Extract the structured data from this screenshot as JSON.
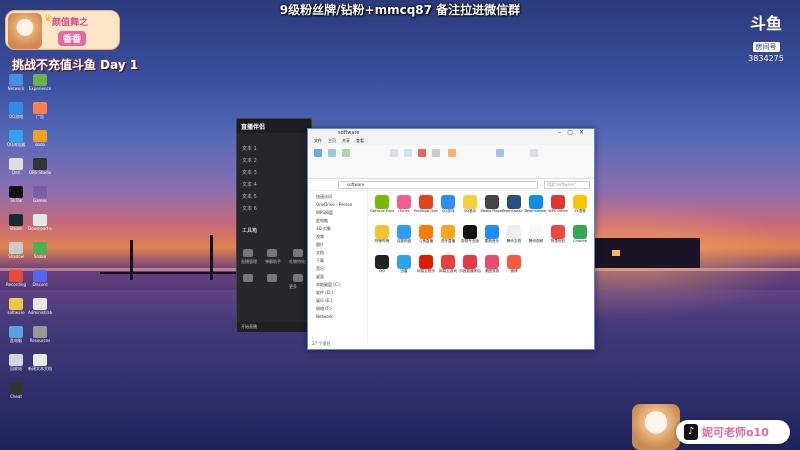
{
  "overlay": {
    "top_banner": "9级粉丝牌/钻粉+mmcq87 备注拉进微信群",
    "badge_title": "颜值舞之",
    "badge_name": "香香",
    "challenge_text": "挑战不充值斗鱼 Day 1",
    "platform_logo": "斗鱼",
    "room_label": "房间号",
    "room_id": "3834275",
    "streamer_handle": "妮可老师o10"
  },
  "desktop_icons": [
    {
      "label": "Network",
      "color": "#4a90e2"
    },
    {
      "label": "Experience",
      "color": "#6ab04c"
    },
    {
      "label": "QQ游戏",
      "color": "#2f8be6"
    },
    {
      "label": "广告",
      "color": "#ff7f50"
    },
    {
      "label": "QQ浏览器",
      "color": "#2fa3f0"
    },
    {
      "label": "dodo",
      "color": "#f0a020"
    },
    {
      "label": "Dell",
      "color": "#ddd"
    },
    {
      "label": "OBS Studio",
      "color": "#333"
    },
    {
      "label": "TikTok",
      "color": "#111"
    },
    {
      "label": "Games",
      "color": "#7b5ea7"
    },
    {
      "label": "Steam",
      "color": "#1b2838"
    },
    {
      "label": "Download software",
      "color": "#e6e6e6"
    },
    {
      "label": "Shadow",
      "color": "#ccc"
    },
    {
      "label": "Snake",
      "color": "#4caf50"
    },
    {
      "label": "Recording",
      "color": "#e74c3c"
    },
    {
      "label": "Discord",
      "color": "#5865f2"
    },
    {
      "label": "software",
      "color": "#f5c542"
    },
    {
      "label": "Administrator",
      "color": "#e8e8e8"
    },
    {
      "label": "此电脑",
      "color": "#5aa0e0"
    },
    {
      "label": "Resources",
      "color": "#999"
    },
    {
      "label": "回收站",
      "color": "#cfd8e3"
    },
    {
      "label": "新建文本文档",
      "color": "#e8e8e8"
    },
    {
      "label": "Cheat",
      "color": "#333"
    }
  ],
  "dark_app": {
    "logo": "直播伴侣",
    "items": [
      "文本 1",
      "文本 2",
      "文本 3",
      "文本 4",
      "文本 5",
      "文本 6"
    ],
    "section": "工具箱",
    "tools": [
      "直播管理",
      "弹幕助手",
      "礼物特效",
      "更多"
    ],
    "status": "开始直播"
  },
  "explorer": {
    "title": "software",
    "tabs": [
      "文件",
      "主页",
      "共享",
      "查看"
    ],
    "address": "software",
    "search_placeholder": "搜索\"software\"",
    "nav": [
      "快速访问",
      "OneDrive - Person",
      "WPS网盘",
      "此电脑",
      "3D 对象",
      "视频",
      "图片",
      "文档",
      "下载",
      "音乐",
      "桌面",
      "本地磁盘 (C:)",
      "软件 (D:)",
      "娱乐 (E:)",
      "网络 (F:)",
      "Network"
    ],
    "apps": [
      {
        "label": "GeForce Experience",
        "color": "#76b900"
      },
      {
        "label": "iTunes",
        "color": "#f25d8e"
      },
      {
        "label": "ProShow Gold",
        "color": "#e0441e"
      },
      {
        "label": "QQ游戏",
        "color": "#2e8df0"
      },
      {
        "label": "QQ音乐",
        "color": "#f4d03f"
      },
      {
        "label": "Media Player",
        "color": "#444"
      },
      {
        "label": "TeamSpeak 3",
        "color": "#2c4f7c"
      },
      {
        "label": "TeamViewer",
        "color": "#0e8ee9"
      },
      {
        "label": "WPS Office",
        "color": "#e3342f"
      },
      {
        "label": "YY语音",
        "color": "#f7c600"
      },
      {
        "label": "哔哩哔哩",
        "color": "#f4c430"
      },
      {
        "label": "百度网盘",
        "color": "#2f9df4"
      },
      {
        "label": "斗鱼直播",
        "color": "#ff7a00"
      },
      {
        "label": "虎牙直播",
        "color": "#f5a623"
      },
      {
        "label": "剪映专业版",
        "color": "#111"
      },
      {
        "label": "酷狗音乐",
        "color": "#1d8cf8"
      },
      {
        "label": "腾讯文档",
        "color": "#eeeeee"
      },
      {
        "label": "腾讯视频",
        "color": "#f8f8f8"
      },
      {
        "label": "阿里旺旺",
        "color": "#e84a3c"
      },
      {
        "label": "Chrome",
        "color": "#34a853"
      },
      {
        "label": "QQ",
        "color": "#222"
      },
      {
        "label": "迅雷",
        "color": "#2ba2ea"
      },
      {
        "label": "网易云音乐",
        "color": "#d81e06"
      },
      {
        "label": "网易云游戏",
        "color": "#ea3d3d"
      },
      {
        "label": "抖音直播伴侣",
        "color": "#e63946"
      },
      {
        "label": "美图秀秀",
        "color": "#e84b6b"
      },
      {
        "label": "微博",
        "color": "#f55a3c"
      }
    ],
    "status": "27 个项目"
  }
}
